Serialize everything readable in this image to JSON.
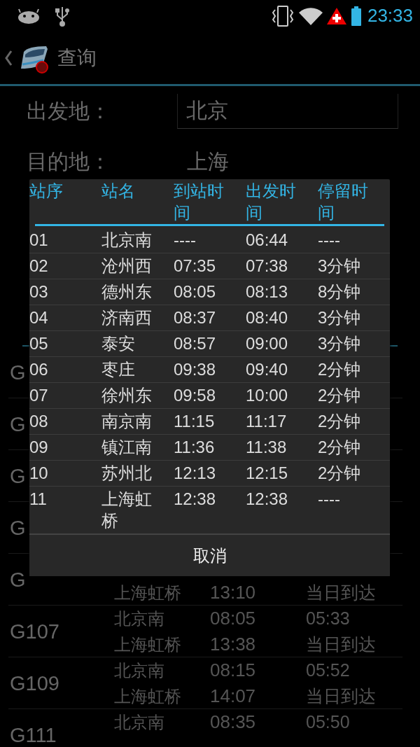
{
  "status_bar": {
    "time": "23:33"
  },
  "action_bar": {
    "title": "查询"
  },
  "form": [
    {
      "kind": "field",
      "label": "出发地：",
      "value": "北京"
    },
    {
      "kind": "plain",
      "label": "目的地：",
      "value": "上海"
    }
  ],
  "trains": [
    {
      "code": "G"
    },
    {
      "code": "G"
    },
    {
      "code": "G"
    },
    {
      "code": "G"
    },
    {
      "code": "G",
      "to": "上海虹桥",
      "arrive_time": "13:10",
      "arrival": "当日到达"
    },
    {
      "code": "G107",
      "from": "北京南",
      "depart_time": "08:05",
      "duration": "05:33",
      "to": "上海虹桥",
      "arrive_time": "13:38",
      "arrival": "当日到达"
    },
    {
      "code": "G109",
      "from": "北京南",
      "depart_time": "08:15",
      "duration": "05:52",
      "to": "上海虹桥",
      "arrive_time": "14:07",
      "arrival": "当日到达"
    },
    {
      "code": "G111",
      "from": "北京南",
      "depart_time": "08:35",
      "duration": "05:50"
    }
  ],
  "dialog": {
    "columns": [
      "站序",
      "站名",
      "到站时间",
      "出发时间",
      "停留时间"
    ],
    "rows": [
      [
        "01",
        "北京南",
        "----",
        "06:44",
        "----"
      ],
      [
        "02",
        "沧州西",
        "07:35",
        "07:38",
        "3分钟"
      ],
      [
        "03",
        "德州东",
        "08:05",
        "08:13",
        "8分钟"
      ],
      [
        "04",
        "济南西",
        "08:37",
        "08:40",
        "3分钟"
      ],
      [
        "05",
        "泰安",
        "08:57",
        "09:00",
        "3分钟"
      ],
      [
        "06",
        "枣庄",
        "09:38",
        "09:40",
        "2分钟"
      ],
      [
        "07",
        "徐州东",
        "09:58",
        "10:00",
        "2分钟"
      ],
      [
        "08",
        "南京南",
        "11:15",
        "11:17",
        "2分钟"
      ],
      [
        "09",
        "镇江南",
        "11:36",
        "11:38",
        "2分钟"
      ],
      [
        "10",
        "苏州北",
        "12:13",
        "12:15",
        "2分钟"
      ],
      [
        "11",
        "上海虹桥",
        "12:38",
        "12:38",
        "----"
      ]
    ],
    "cancel": "取消"
  }
}
